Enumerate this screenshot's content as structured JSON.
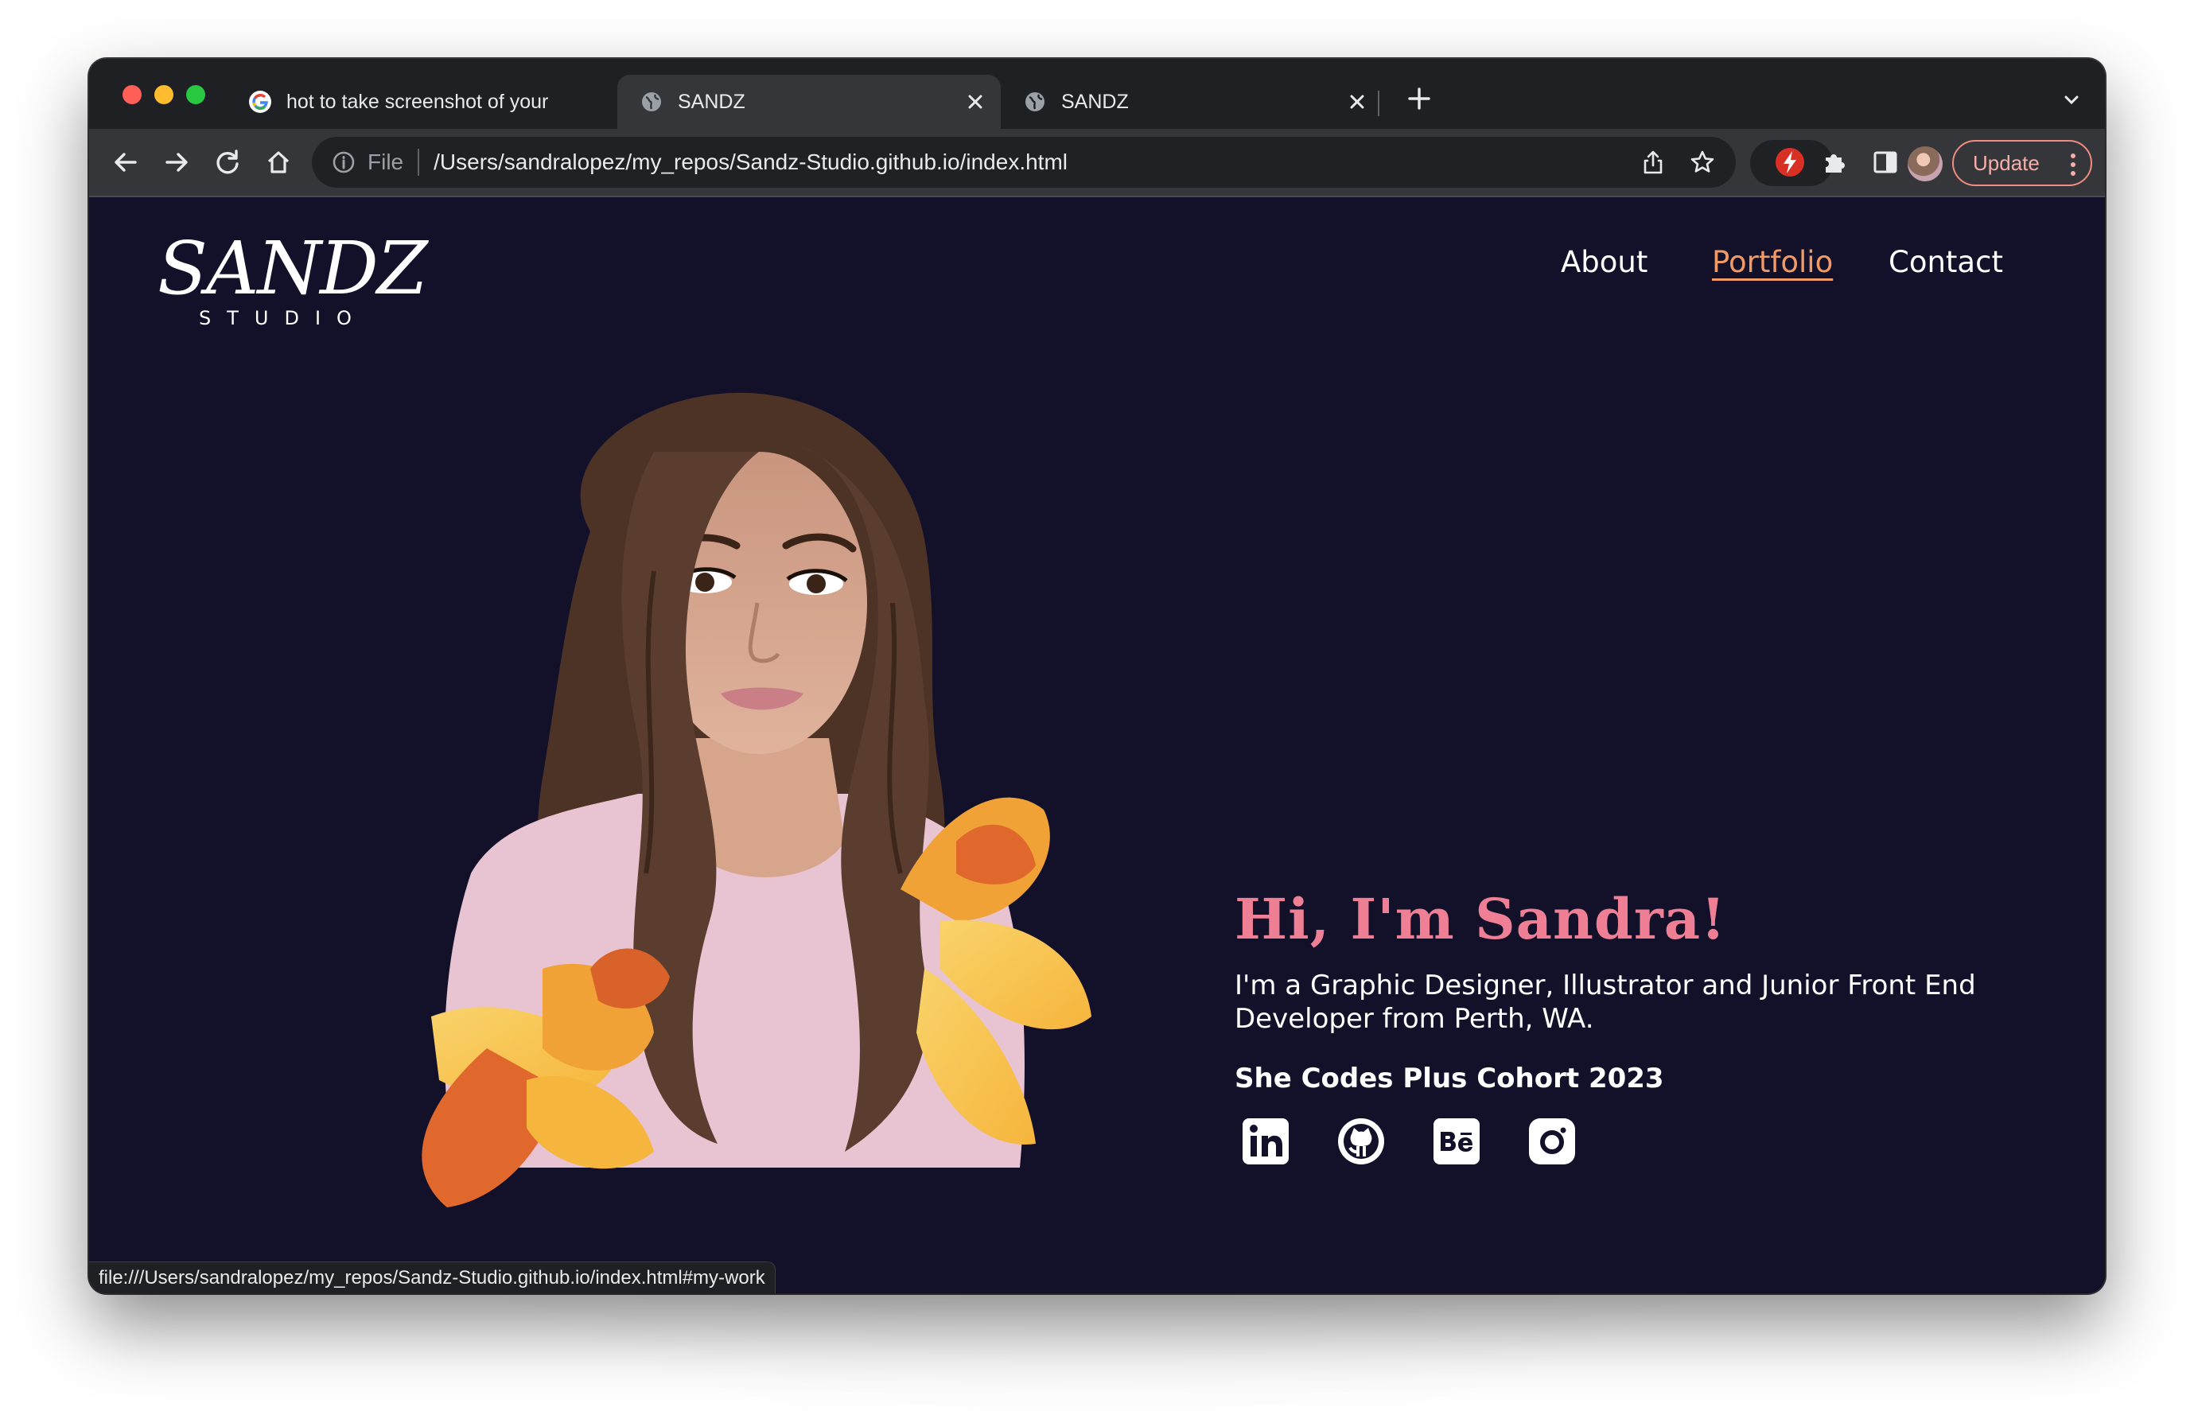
{
  "browser": {
    "tabs": [
      {
        "title": "hot to take screenshot of your ",
        "favicon": "google-icon",
        "active": false
      },
      {
        "title": "SANDZ",
        "favicon": "globe-icon",
        "active": true
      },
      {
        "title": "SANDZ",
        "favicon": "globe-icon",
        "active": false
      }
    ],
    "address_scheme_label": "File",
    "address_url": "/Users/sandralopez/my_repos/Sandz-Studio.github.io/index.html",
    "update_label": "Update",
    "status_url": "file:///Users/sandralopez/my_repos/Sandz-Studio.github.io/index.html#my-work"
  },
  "site": {
    "logo_main": "SANDZ",
    "logo_sub": "STUDIO",
    "nav": [
      {
        "label": "About",
        "active": false
      },
      {
        "label": "Portfolio",
        "active": true
      },
      {
        "label": "Contact",
        "active": false
      }
    ],
    "hero": {
      "title": "Hi, I'm Sandra!",
      "description": "I'm a Graphic Designer, Illustrator and Junior Front End Developer from Perth, WA.",
      "cohort": "She Codes Plus Cohort 2023"
    },
    "socials": [
      "linkedin-icon",
      "github-icon",
      "behance-icon",
      "instagram-icon"
    ]
  },
  "colors": {
    "page_bg": "#13102a",
    "accent_pink": "#ee7f95",
    "nav_active": "#f19a63",
    "chrome_bar": "#1f2024",
    "chrome_toolbar": "#35363a"
  }
}
